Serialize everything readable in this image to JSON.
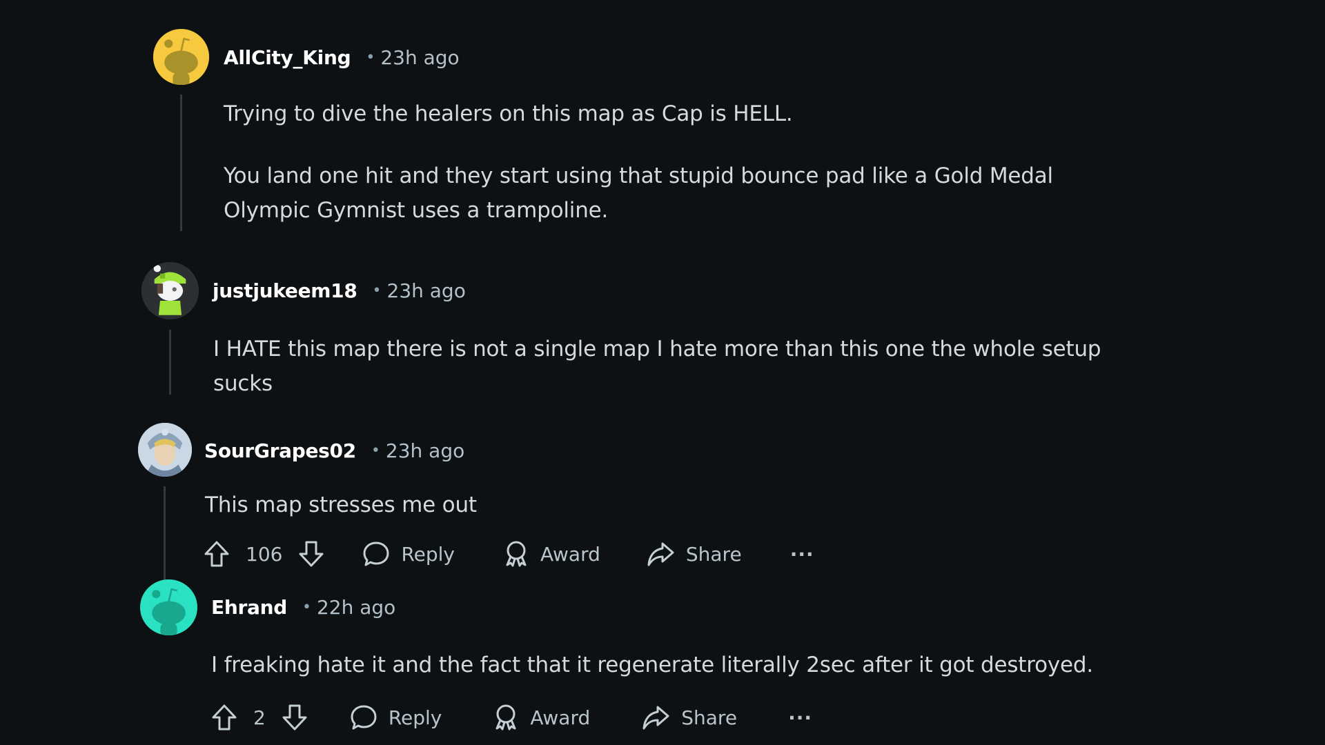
{
  "theme": {
    "background": "#0e1113",
    "text": "#d7dadc",
    "muted": "#b3c2ca",
    "thread_line": "#33393d"
  },
  "comments": [
    {
      "username": "AllCity_King",
      "separator": "•",
      "time": "23h ago",
      "avatar": {
        "type": "snoo-default",
        "color": "#f7c940",
        "icon": "snoo-avatar-icon"
      },
      "paragraphs": [
        "Trying to dive the healers on this map as Cap is HELL.",
        "You land one hit and they start using that stupid bounce pad like a Gold Medal Olympic Gymnist uses a trampoline."
      ]
    },
    {
      "username": "justjukeem18",
      "separator": "•",
      "time": "23h ago",
      "avatar": {
        "type": "custom",
        "color": "#2a2e31",
        "icon": "green-beanie-character-avatar"
      },
      "paragraphs": [
        "I HATE this map there is not a single map I hate more than this one the whole setup sucks"
      ]
    },
    {
      "username": "SourGrapes02",
      "separator": "•",
      "time": "23h ago",
      "avatar": {
        "type": "custom",
        "color": "#c9d7e6",
        "icon": "anime-character-avatar"
      },
      "paragraphs": [
        "This map stresses me out"
      ],
      "actions": {
        "score": "106",
        "reply": "Reply",
        "award": "Award",
        "share": "Share",
        "more": "···"
      }
    },
    {
      "username": "Ehrand",
      "separator": "•",
      "time": "22h ago",
      "avatar": {
        "type": "snoo-default",
        "color": "#2ae0c0",
        "icon": "snoo-avatar-icon"
      },
      "paragraphs": [
        "I freaking hate it and the fact that it regenerate literally 2sec after it got destroyed."
      ],
      "actions": {
        "score": "2",
        "reply": "Reply",
        "award": "Award",
        "share": "Share",
        "more": "···"
      }
    }
  ]
}
